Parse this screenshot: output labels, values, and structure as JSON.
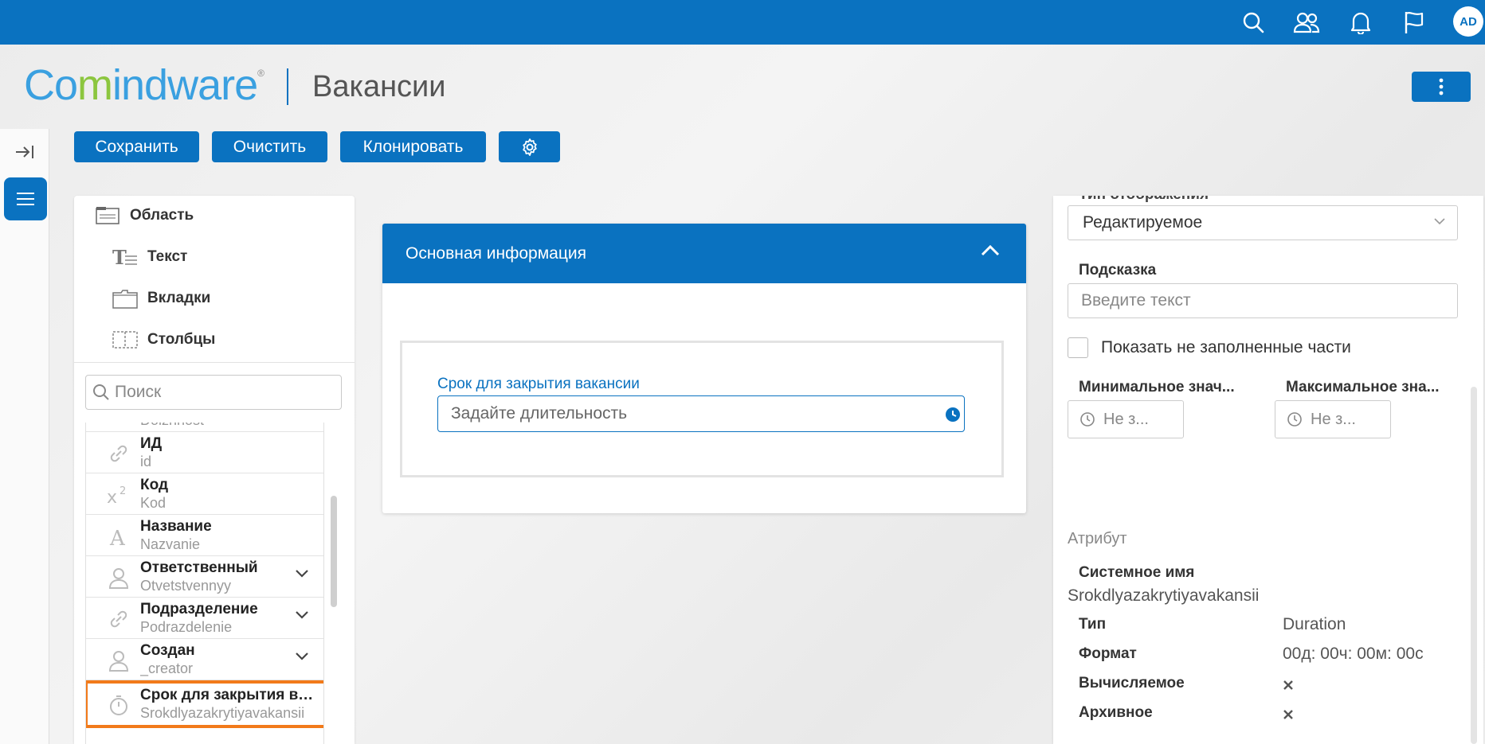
{
  "topbar": {
    "icons": [
      "search-icon",
      "users-icon",
      "bell-icon",
      "flag-icon"
    ],
    "avatar": "AD"
  },
  "header": {
    "logo_part1": "Co",
    "logo_part2": "m",
    "logo_part3": "indware",
    "logo_mark": "®",
    "title": "Вакансии"
  },
  "toolbar": {
    "save": "Сохранить",
    "clear": "Очистить",
    "clone": "Клонировать"
  },
  "components": [
    {
      "label": "Область",
      "icon": "area-icon"
    },
    {
      "label": "Текст",
      "icon": "text-icon"
    },
    {
      "label": "Вкладки",
      "icon": "tabs-icon"
    },
    {
      "label": "Столбцы",
      "icon": "columns-icon"
    }
  ],
  "search": {
    "placeholder": "Поиск"
  },
  "attributes": [
    {
      "name": "",
      "system": "Dolzhnost",
      "icon": "none"
    },
    {
      "name": "ИД",
      "system": "id",
      "icon": "link-icon"
    },
    {
      "name": "Код",
      "system": "Kod",
      "icon": "superscript-icon"
    },
    {
      "name": "Название",
      "system": "Nazvanie",
      "icon": "letter-a-icon"
    },
    {
      "name": "Ответственный",
      "system": "Otvetstvennyy",
      "icon": "user-icon"
    },
    {
      "name": "Подразделение",
      "system": "Podrazdelenie",
      "icon": "link-icon"
    },
    {
      "name": "Создан",
      "system": "_creator",
      "icon": "user-icon"
    },
    {
      "name": "Срок для закрытия вакансии",
      "system": "Srokdlyazakrytiyavakansii",
      "icon": "stopwatch-icon"
    }
  ],
  "card": {
    "title": "Основная информация",
    "field_label": "Срок для закрытия вакансии",
    "field_placeholder": "Задайте длительность"
  },
  "properties": {
    "display_type_label": "Тип отображения",
    "display_type_value": "Редактируемое",
    "hint_label": "Подсказка",
    "hint_placeholder": "Введите текст",
    "show_empty_label": "Показать не заполненные части",
    "min_label": "Минимальное знач...",
    "max_label": "Максимальное зна...",
    "min_placeholder": "Не з...",
    "max_placeholder": "Не з...",
    "attribute_section": "Атрибут",
    "system_name_label": "Системное имя",
    "system_name_value": "Srokdlyazakrytiyavakansii",
    "type_label": "Тип",
    "type_value": "Duration",
    "format_label": "Формат",
    "format_value": "00д: 00ч: 00м: 00с",
    "computed_label": "Вычисляемое",
    "archived_label": "Архивное"
  },
  "colors": {
    "primary": "#0a72c0",
    "highlight": "#f27a1a",
    "logo_blue": "#3aa0e0",
    "logo_green": "#8cc63f"
  }
}
